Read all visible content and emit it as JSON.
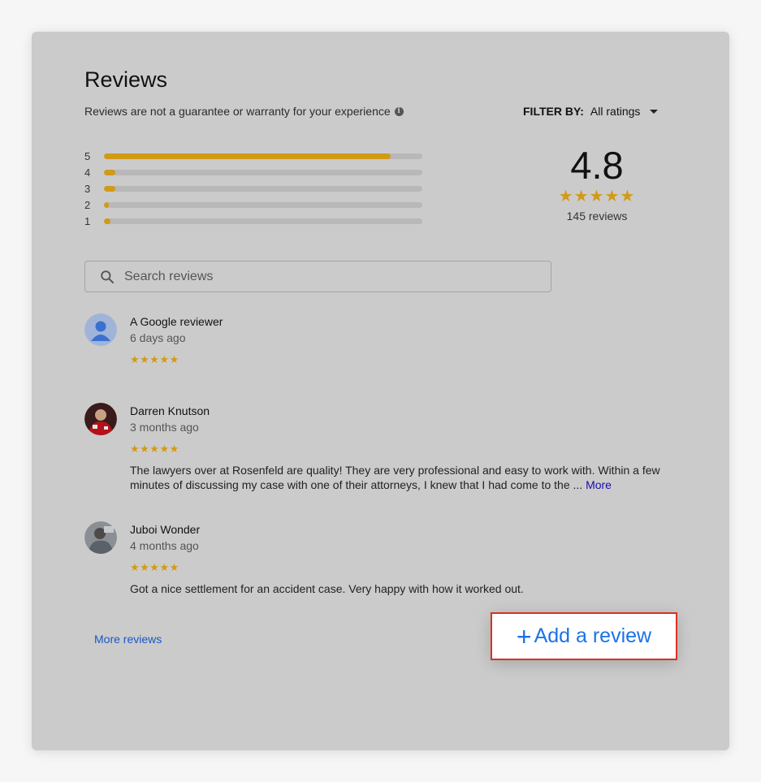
{
  "header": {
    "title": "Reviews",
    "disclaimer": "Reviews are not a guarantee or warranty for your experience",
    "info_icon": "info-icon"
  },
  "filter": {
    "label": "FILTER BY:",
    "value": "All ratings"
  },
  "histogram": [
    {
      "stars": "5",
      "fraction": 0.9
    },
    {
      "stars": "4",
      "fraction": 0.035
    },
    {
      "stars": "3",
      "fraction": 0.035
    },
    {
      "stars": "2",
      "fraction": 0.015
    },
    {
      "stars": "1",
      "fraction": 0.02
    }
  ],
  "summary": {
    "rating": "4.8",
    "stars": "★★★★★",
    "count": "145 reviews"
  },
  "search": {
    "placeholder": "Search reviews"
  },
  "reviews": [
    {
      "name": "A Google reviewer",
      "time": "6 days ago",
      "stars": "★★★★★",
      "text": ""
    },
    {
      "name": "Darren Knutson",
      "time": "3 months ago",
      "stars": "★★★★★",
      "text": "The lawyers over at Rosenfeld are quality! They are very professional and easy to work with. Within a few minutes of discussing my case with one of their attorneys, I knew that I had come to the ...",
      "more": "More"
    },
    {
      "name": "Juboi Wonder",
      "time": "4 months ago",
      "stars": "★★★★★",
      "text": "Got a nice settlement for an accident case. Very happy with how it worked out."
    }
  ],
  "footer": {
    "more_reviews": "More reviews",
    "add_review_plus": "+",
    "add_review": "Add a review"
  },
  "colors": {
    "star": "#d19a17",
    "link": "#1a56c4",
    "add_review": "#1a73e8",
    "highlight_border": "#d93025"
  }
}
